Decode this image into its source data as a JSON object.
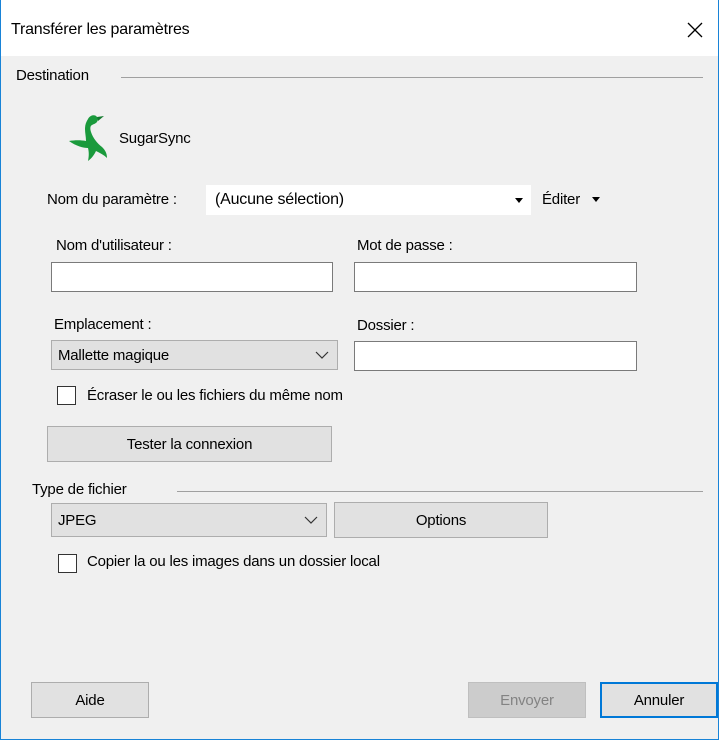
{
  "window": {
    "title": "Transférer les paramètres"
  },
  "destination": {
    "group_label": "Destination",
    "service_name": "SugarSync",
    "setting_label": "Nom du paramètre :",
    "setting_value": "(Aucune sélection)",
    "edit_label": "Éditer",
    "username_label": "Nom d'utilisateur :",
    "username_value": "",
    "password_label": "Mot de passe :",
    "password_value": "",
    "location_label": "Emplacement :",
    "location_value": "Mallette magique",
    "folder_label": "Dossier :",
    "folder_value": "",
    "overwrite_label": "Écraser le ou les fichiers du même nom",
    "overwrite_checked": false,
    "test_button": "Tester la connexion"
  },
  "file_type": {
    "group_label": "Type de fichier",
    "value": "JPEG",
    "options_button": "Options",
    "copy_local_label": "Copier la ou les images dans un dossier local",
    "copy_local_checked": false
  },
  "footer": {
    "help_button": "Aide",
    "send_button": "Envoyer",
    "cancel_button": "Annuler"
  },
  "colors": {
    "accent": "#0078d7",
    "logo_green": "#1a9a3c",
    "window_bg": "#f0f0f0"
  }
}
